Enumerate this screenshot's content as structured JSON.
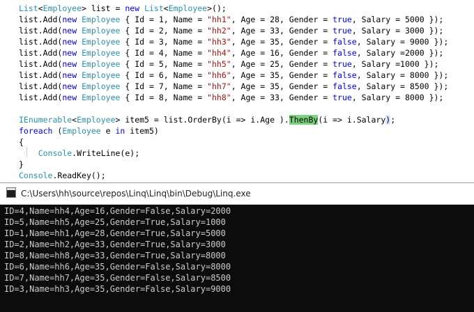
{
  "editor": {
    "lines": [
      [
        [
          "type",
          "List"
        ],
        [
          "id",
          "<"
        ],
        [
          "type",
          "Employee"
        ],
        [
          "id",
          "> list = "
        ],
        [
          "kw",
          "new"
        ],
        [
          "id",
          " "
        ],
        [
          "type",
          "List"
        ],
        [
          "id",
          "<"
        ],
        [
          "type",
          "Employee"
        ],
        [
          "id",
          ">();"
        ]
      ],
      [
        [
          "id",
          "list."
        ],
        [
          "method",
          "Add"
        ],
        [
          "id",
          "("
        ],
        [
          "kw",
          "new"
        ],
        [
          "id",
          " "
        ],
        [
          "type",
          "Employee"
        ],
        [
          "id",
          " { Id = 1, Name = "
        ],
        [
          "str",
          "\"hh1\""
        ],
        [
          "id",
          ", Age = 28, Gender = "
        ],
        [
          "kw",
          "true"
        ],
        [
          "id",
          ", Salary = 5000 });"
        ]
      ],
      [
        [
          "id",
          "list."
        ],
        [
          "method",
          "Add"
        ],
        [
          "id",
          "("
        ],
        [
          "kw",
          "new"
        ],
        [
          "id",
          " "
        ],
        [
          "type",
          "Employee"
        ],
        [
          "id",
          " { Id = 2, Name = "
        ],
        [
          "str",
          "\"hh2\""
        ],
        [
          "id",
          ", Age = 33, Gender = "
        ],
        [
          "kw",
          "true"
        ],
        [
          "id",
          ", Salary = 3000 });"
        ]
      ],
      [
        [
          "id",
          "list."
        ],
        [
          "method",
          "Add"
        ],
        [
          "id",
          "("
        ],
        [
          "kw",
          "new"
        ],
        [
          "id",
          " "
        ],
        [
          "type",
          "Employee"
        ],
        [
          "id",
          " { Id = 3, Name = "
        ],
        [
          "str",
          "\"hh3\""
        ],
        [
          "id",
          ", Age = 35, Gender = "
        ],
        [
          "kw",
          "false"
        ],
        [
          "id",
          ", Salary = 9000 });"
        ]
      ],
      [
        [
          "id",
          "list."
        ],
        [
          "method",
          "Add"
        ],
        [
          "id",
          "("
        ],
        [
          "kw",
          "new"
        ],
        [
          "id",
          " "
        ],
        [
          "type",
          "Employee"
        ],
        [
          "id",
          " { Id = 4, Name = "
        ],
        [
          "str",
          "\"hh4\""
        ],
        [
          "id",
          ", Age = 16, Gender = "
        ],
        [
          "kw",
          "false"
        ],
        [
          "id",
          ", Salary =2000 });"
        ]
      ],
      [
        [
          "id",
          "list."
        ],
        [
          "method",
          "Add"
        ],
        [
          "id",
          "("
        ],
        [
          "kw",
          "new"
        ],
        [
          "id",
          " "
        ],
        [
          "type",
          "Employee"
        ],
        [
          "id",
          " { Id = 5, Name = "
        ],
        [
          "str",
          "\"hh5\""
        ],
        [
          "id",
          ", Age = 25, Gender = "
        ],
        [
          "kw",
          "true"
        ],
        [
          "id",
          ", Salary =1000 });"
        ]
      ],
      [
        [
          "id",
          "list."
        ],
        [
          "method",
          "Add"
        ],
        [
          "id",
          "("
        ],
        [
          "kw",
          "new"
        ],
        [
          "id",
          " "
        ],
        [
          "type",
          "Employee"
        ],
        [
          "id",
          " { Id = 6, Name = "
        ],
        [
          "str",
          "\"hh6\""
        ],
        [
          "id",
          ", Age = 35, Gender = "
        ],
        [
          "kw",
          "false"
        ],
        [
          "id",
          ", Salary = 8000 });"
        ]
      ],
      [
        [
          "id",
          "list."
        ],
        [
          "method",
          "Add"
        ],
        [
          "id",
          "("
        ],
        [
          "kw",
          "new"
        ],
        [
          "id",
          " "
        ],
        [
          "type",
          "Employee"
        ],
        [
          "id",
          " { Id = 7, Name = "
        ],
        [
          "str",
          "\"hh7\""
        ],
        [
          "id",
          ", Age = 35, Gender = "
        ],
        [
          "kw",
          "false"
        ],
        [
          "id",
          ", Salary = 8500 });"
        ]
      ],
      [
        [
          "id",
          "list."
        ],
        [
          "method",
          "Add"
        ],
        [
          "id",
          "("
        ],
        [
          "kw",
          "new"
        ],
        [
          "id",
          " "
        ],
        [
          "type",
          "Employee"
        ],
        [
          "id",
          " { Id = 8, Name = "
        ],
        [
          "str",
          "\"hh8\""
        ],
        [
          "id",
          ", Age = 33, Gender = "
        ],
        [
          "kw",
          "true"
        ],
        [
          "id",
          ", Salary = 8000 });"
        ]
      ],
      [],
      [
        [
          "type",
          "IEnumerable"
        ],
        [
          "id",
          "<"
        ],
        [
          "type",
          "Employee"
        ],
        [
          "id",
          "> item5 = list."
        ],
        [
          "method",
          "OrderBy"
        ],
        [
          "id",
          "(i => i.Age )."
        ],
        [
          "hl",
          "ThenBy"
        ],
        [
          "id",
          "(i => i.Salary"
        ],
        [
          "bracket",
          ")"
        ],
        [
          "id",
          ";"
        ]
      ],
      [
        [
          "kw",
          "foreach"
        ],
        [
          "id",
          " ("
        ],
        [
          "type",
          "Employee"
        ],
        [
          "id",
          " e "
        ],
        [
          "kw",
          "in"
        ],
        [
          "id",
          " item5)"
        ]
      ],
      [
        [
          "id",
          "{"
        ]
      ],
      [
        [
          "id",
          "    "
        ],
        [
          "type",
          "Console"
        ],
        [
          "id",
          "."
        ],
        [
          "method",
          "WriteLine"
        ],
        [
          "id",
          "(e);"
        ]
      ],
      [
        [
          "id",
          "}"
        ]
      ],
      [
        [
          "type",
          "Console"
        ],
        [
          "id",
          "."
        ],
        [
          "method",
          "ReadKey"
        ],
        [
          "id",
          "();"
        ]
      ]
    ]
  },
  "console": {
    "title": "C:\\Users\\hh\\source\\repos\\Linq\\Linq\\bin\\Debug\\Linq.exe",
    "icon": "console-app-icon",
    "output": [
      "ID=4,Name=hh4,Age=16,Gender=False,Salary=2000",
      "ID=5,Name=hh5,Age=25,Gender=True,Salary=1000",
      "ID=1,Name=hh1,Age=28,Gender=True,Salary=5000",
      "ID=2,Name=hh2,Age=33,Gender=True,Salary=3000",
      "ID=8,Name=hh8,Age=33,Gender=True,Salary=8000",
      "ID=6,Name=hh6,Age=35,Gender=False,Salary=8000",
      "ID=7,Name=hh7,Age=35,Gender=False,Salary=8500",
      "ID=3,Name=hh3,Age=35,Gender=False,Salary=9000"
    ]
  },
  "colors": {
    "keyword": "#0000ff",
    "type": "#2b91af",
    "string": "#a31515",
    "highlight": "#7cd27c",
    "console_bg": "#0c0c0c",
    "console_text": "#cccccc"
  }
}
